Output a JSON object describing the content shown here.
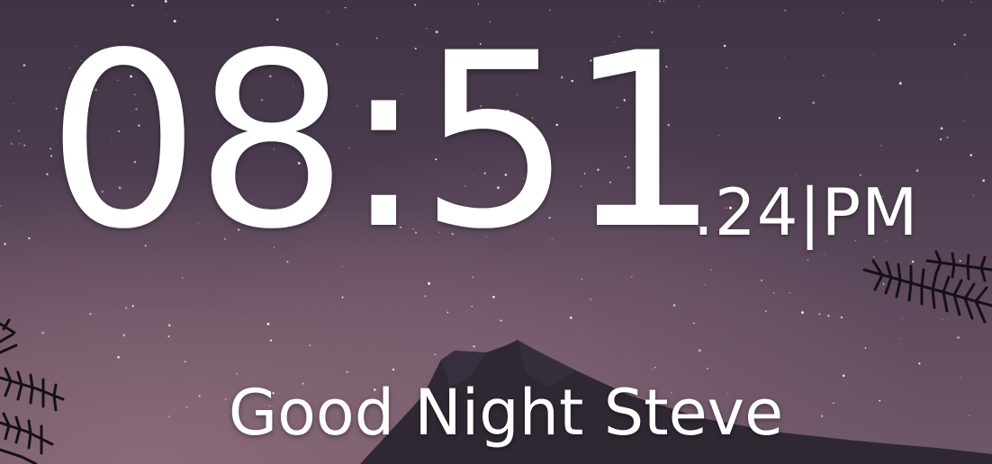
{
  "clock": {
    "hours_minutes": "08:51",
    "seconds": ".24",
    "separator": "|",
    "meridiem": "PM"
  },
  "greeting": {
    "text": "Good Night Steve"
  },
  "wallpaper": {
    "scene": "starry night sky over mountain with pine branches",
    "sky_top_color": "#3e3444",
    "sky_bottom_color": "#6e5868",
    "mountain_color": "#2f2833",
    "branch_color": "#141114"
  }
}
